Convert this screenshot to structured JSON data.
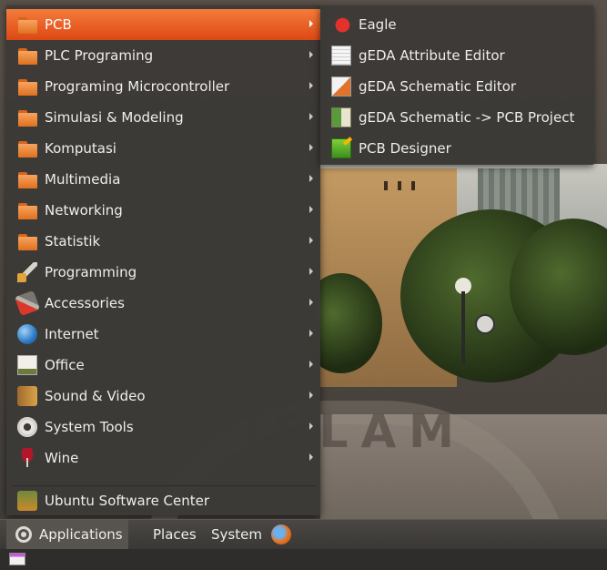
{
  "main_menu": {
    "items": [
      {
        "label": "PCB",
        "icon": "folder-icon",
        "has_submenu": true,
        "active": true
      },
      {
        "label": "PLC Programing",
        "icon": "folder-icon",
        "has_submenu": true
      },
      {
        "label": "Programing Microcontroller",
        "icon": "folder-icon",
        "has_submenu": true
      },
      {
        "label": "Simulasi & Modeling",
        "icon": "folder-icon",
        "has_submenu": true
      },
      {
        "label": "Komputasi",
        "icon": "folder-icon",
        "has_submenu": true
      },
      {
        "label": "Multimedia",
        "icon": "folder-icon",
        "has_submenu": true
      },
      {
        "label": "Networking",
        "icon": "folder-icon",
        "has_submenu": true
      },
      {
        "label": "Statistik",
        "icon": "folder-icon",
        "has_submenu": true
      },
      {
        "label": "Programming",
        "icon": "wrench-icon",
        "has_submenu": true
      },
      {
        "label": "Accessories",
        "icon": "accessories-icon",
        "has_submenu": true
      },
      {
        "label": "Internet",
        "icon": "globe-icon",
        "has_submenu": true
      },
      {
        "label": "Office",
        "icon": "office-icon",
        "has_submenu": true
      },
      {
        "label": "Sound & Video",
        "icon": "sound-video-icon",
        "has_submenu": true
      },
      {
        "label": "System Tools",
        "icon": "gear-icon",
        "has_submenu": true
      },
      {
        "label": "Wine",
        "icon": "wine-icon",
        "has_submenu": true
      },
      {
        "label": "Ubuntu Software Center",
        "icon": "software-center-icon",
        "has_submenu": false
      }
    ]
  },
  "pcb_submenu": {
    "items": [
      {
        "label": "Eagle",
        "icon": "eagle-icon"
      },
      {
        "label": "gEDA Attribute Editor",
        "icon": "geda-attribute-editor-icon"
      },
      {
        "label": "gEDA Schematic Editor",
        "icon": "geda-schematic-editor-icon"
      },
      {
        "label": "gEDA Schematic -> PCB Project",
        "icon": "geda-pcb-project-icon"
      },
      {
        "label": "PCB Designer",
        "icon": "pcb-designer-icon"
      }
    ]
  },
  "panel": {
    "applications": "Applications",
    "places": "Places",
    "system": "System",
    "launcher_icon": "firefox-icon"
  },
  "wallpaper": {
    "watermark_text": "ISLAM"
  },
  "colors": {
    "active_item": "#dd4814",
    "menu_bg": "#3c3a37",
    "panel_bg": "#3a3835"
  }
}
